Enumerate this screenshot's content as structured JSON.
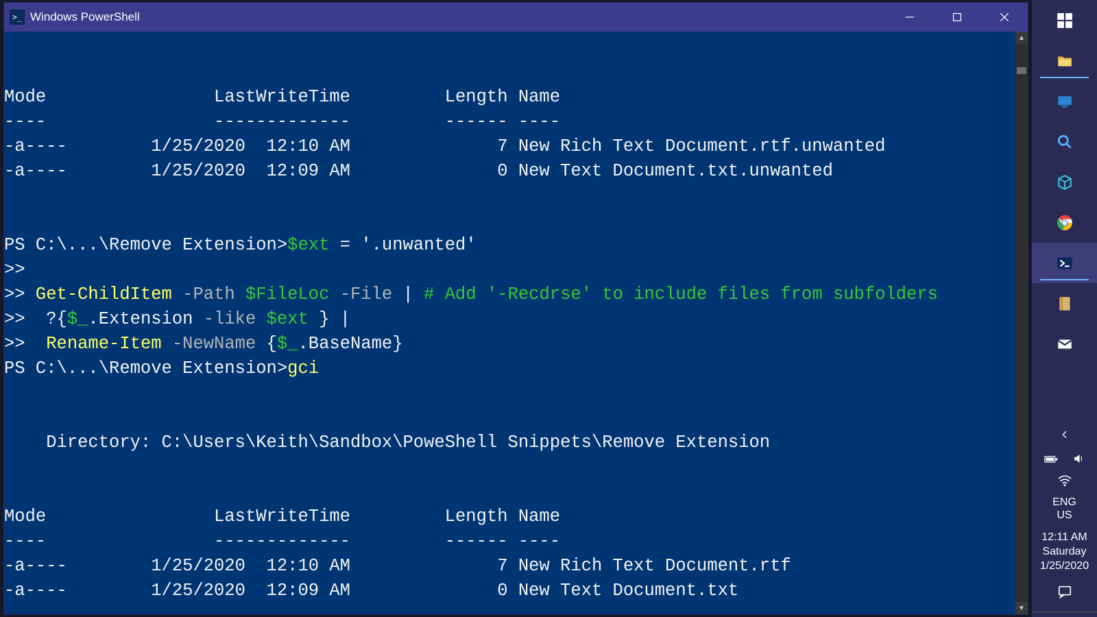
{
  "window": {
    "title": "Windows PowerShell",
    "icon_glyph": ">_"
  },
  "term": {
    "blank_top": "",
    "header_line": "Mode                LastWriteTime         Length Name",
    "header_rule": "----                -------------         ------ ----",
    "before_rows": [
      "-a----        1/25/2020  12:10 AM              7 New Rich Text Document.rtf.unwanted",
      "-a----        1/25/2020  12:09 AM              0 New Text Document.txt.unwanted"
    ],
    "prompt1_prefix": "PS C:\\...\\Remove Extension>",
    "cmd1_var": "$ext",
    "cmd1_rest_a": " = ",
    "cmd1_string": "'.unwanted'",
    "cont1": ">>",
    "cont2": ">> ",
    "cmd2_cmdlet": "Get-ChildItem",
    "cmd2_param1": " -Path ",
    "cmd2_var1": "$FileLoc",
    "cmd2_param2": " -File ",
    "cmd2_pipe": "|",
    "cmd2_comment": " # Add '-Recdrse' to include files from subfolders",
    "cont3": ">>  ",
    "cmd3_a": "?{",
    "cmd3_var": "$_",
    "cmd3_b": ".Extension",
    "cmd3_param": " -like ",
    "cmd3_var2": "$ext",
    "cmd3_c": " } ",
    "cmd3_pipe": "|",
    "cont4": ">>  ",
    "cmd4_cmdlet": "Rename-Item",
    "cmd4_param": " -NewName ",
    "cmd4_a": "{",
    "cmd4_var": "$_",
    "cmd4_b": ".BaseName}",
    "prompt2_prefix": "PS C:\\...\\Remove Extension>",
    "prompt2_cmd": "gci",
    "dir_line": "    Directory: C:\\Users\\Keith\\Sandbox\\PoweShell Snippets\\Remove Extension",
    "after_rows": [
      "-a----        1/25/2020  12:10 AM              7 New Rich Text Document.rtf",
      "-a----        1/25/2020  12:09 AM              0 New Text Document.txt"
    ]
  },
  "tray": {
    "lang1": "ENG",
    "lang2": "US",
    "time": "12:11 AM",
    "day": "Saturday",
    "date": "1/25/2020"
  }
}
